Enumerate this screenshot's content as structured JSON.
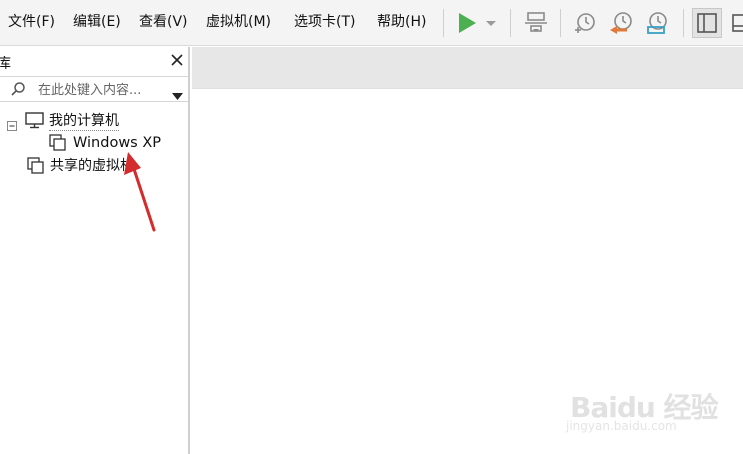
{
  "menu": {
    "file": "文件(F)",
    "edit": "编辑(E)",
    "view": "查看(V)",
    "vm": "虚拟机(M)",
    "tabs": "选项卡(T)",
    "help": "帮助(H)"
  },
  "toolbar_icons": [
    "play-icon",
    "play-dropdown-icon",
    "network-icon",
    "snapshot-take-icon",
    "snapshot-revert-icon",
    "snapshot-manager-icon",
    "library-toggle-icon",
    "thumbnail-icon"
  ],
  "colors": {
    "accent_green": "#4caf50",
    "revert_orange": "#e07a3a",
    "manager_teal": "#3a9fc4",
    "arrow_red": "#d42c2c"
  },
  "library": {
    "title": "库",
    "search_placeholder": "在此处键入内容...",
    "tree": {
      "my_computer": "我的计算机",
      "windows_xp": "Windows XP",
      "shared_vms": "共享的虚拟机"
    }
  },
  "watermark": {
    "main": "Baidu 经验",
    "sub": "jingyan.baidu.com"
  }
}
